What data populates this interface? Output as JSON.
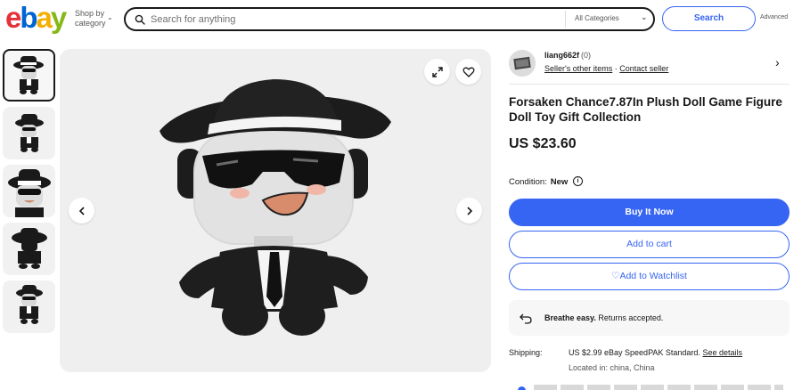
{
  "header": {
    "logo_letters": [
      "e",
      "b",
      "a",
      "y"
    ],
    "shop_by_line1": "Shop by",
    "shop_by_line2": "category",
    "search_placeholder": "Search for anything",
    "category_select": "All Categories",
    "search_button": "Search",
    "advanced_link": "Advanced"
  },
  "gallery": {
    "thumbnails": 5,
    "selected_index": 0
  },
  "seller": {
    "name": "liang662f",
    "feedback": "(0)",
    "other_items": "Seller's other items",
    "separator": "·",
    "contact": "Contact seller"
  },
  "listing": {
    "title": "Forsaken Chance7.87In Plush Doll Game Figure Doll Toy Gift Collection",
    "price": "US $23.60",
    "condition_label": "Condition:",
    "condition_value": "New",
    "buy_now": "Buy It Now",
    "add_to_cart": "Add to cart",
    "add_to_watchlist": "Add to Watchlist",
    "returns_bold": "Breathe easy.",
    "returns_text": "Returns accepted.",
    "shipping_label": "Shipping:",
    "shipping_cost": "US $2.99 eBay SpeedPAK Standard.",
    "shipping_details": "See details",
    "location": "Located in: china, China"
  },
  "colors": {
    "accent_blue": "#3665f3",
    "text": "#191919"
  },
  "icons": [
    "search-icon",
    "chevron-down-icon",
    "expand-icon",
    "heart-icon",
    "chevron-left-icon",
    "chevron-right-icon",
    "info-icon",
    "return-icon"
  ]
}
